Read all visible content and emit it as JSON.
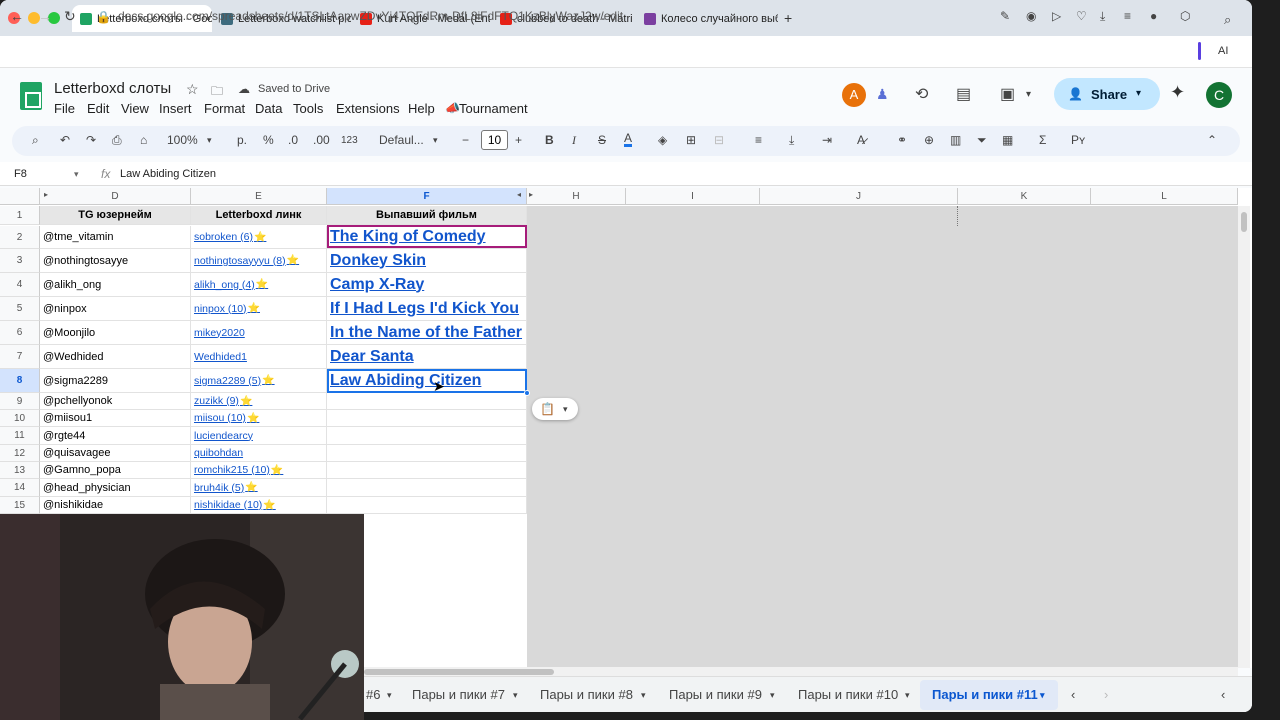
{
  "browser": {
    "tabs": [
      {
        "title": "Letterboxd слоты - Goog",
        "color": "#1fa463",
        "active": true
      },
      {
        "title": "Letterboxd watchlist pic",
        "color": "#3d6b7e",
        "active": false
      },
      {
        "title": "Kurt Angle - Medal (Entr",
        "color": "#e62117",
        "active": false
      },
      {
        "title": "clubbed to death - Matri",
        "color": "#e62117",
        "active": false
      },
      {
        "title": "Колесо случайного выб",
        "color": "#7b3fa0",
        "active": false
      }
    ],
    "url": "docs.google.com/spreadsheets/d/1TSLtAapwZDvYj4TQFdRm-DfL8iFdFTQ1KzBlyWazJ2w/edit",
    "ai_label": "AI"
  },
  "sheets": {
    "title": "Letterboxd слоты",
    "saved": "Saved to Drive",
    "menu": [
      "File",
      "Edit",
      "View",
      "Insert",
      "Format",
      "Data",
      "Tools",
      "Extensions",
      "Help",
      "Tournament"
    ],
    "share": "Share",
    "avatar_a": "A",
    "avatar_c": "C",
    "toolbar": {
      "zoom": "100%",
      "currency": "р.",
      "percent": "%",
      "dec_dec": ".0",
      "dec_inc": ".00",
      "format_num": "123",
      "font": "Defaul...",
      "font_size": "10",
      "bold": "B",
      "italic": "I",
      "strike": "S",
      "text_color": "A"
    },
    "cell_ref": "F8",
    "formula": "Law Abiding Citizen"
  },
  "grid": {
    "col_headers": [
      "D",
      "E",
      "F",
      "H",
      "I",
      "J",
      "K",
      "L"
    ],
    "header_row": {
      "d": "TG юзернейм",
      "e": "Letterboxd линк",
      "f": "Выпавший фильм"
    },
    "rows": [
      {
        "n": "2",
        "d": "@tme_vitamin",
        "e": "sobroken (6)",
        "star": true,
        "f": "The King of Comedy"
      },
      {
        "n": "3",
        "d": "@nothingtosayye",
        "e": "nothingtosayyyu (8)",
        "star": true,
        "f": "Donkey Skin"
      },
      {
        "n": "4",
        "d": "@alikh_ong",
        "e": "alikh_ong (4)",
        "star": true,
        "f": "Camp X-Ray"
      },
      {
        "n": "5",
        "d": "@ninpox",
        "e": "ninpox (10)",
        "star": true,
        "f": "If I Had Legs I'd Kick You"
      },
      {
        "n": "6",
        "d": "@Moonjilo",
        "e": "mikey2020",
        "star": false,
        "f": "In the Name of the Father"
      },
      {
        "n": "7",
        "d": "@Wedhided",
        "e": "Wedhided1",
        "star": false,
        "f": "Dear Santa"
      },
      {
        "n": "8",
        "d": "@sigma2289",
        "e": "sigma2289 (5)",
        "star": true,
        "f": "Law Abiding Citizen"
      },
      {
        "n": "9",
        "d": "@pchellyonok",
        "e": "zuzikk (9)",
        "star": true,
        "f": ""
      },
      {
        "n": "10",
        "d": "@miisou1",
        "e": "miisou (10)",
        "star": true,
        "f": ""
      },
      {
        "n": "11",
        "d": "@rgte44",
        "e": "luciendearcy",
        "star": false,
        "f": ""
      },
      {
        "n": "12",
        "d": "@quisavagee",
        "e": "quibohdan",
        "star": false,
        "f": ""
      },
      {
        "n": "13",
        "d": "@Gamno_popa",
        "e": "romchik215 (10)",
        "star": true,
        "f": ""
      },
      {
        "n": "14",
        "d": "@head_physician",
        "e": "bruh4ik (5)",
        "star": true,
        "f": ""
      },
      {
        "n": "15",
        "d": "@nishikidae",
        "e": "nishikidae (10)",
        "star": true,
        "f": ""
      }
    ],
    "star_glyph": "⭐"
  },
  "sheet_tabs": [
    "#6",
    "Пары и пики #7",
    "Пары и пики #8",
    "Пары и пики #9",
    "Пары и пики #10",
    "Пары и пики #11"
  ],
  "colors": {
    "selection": "#1a73e8",
    "collaborator": "#a61c7a",
    "link": "#1155cc",
    "share_bg": "#c2e7ff"
  }
}
